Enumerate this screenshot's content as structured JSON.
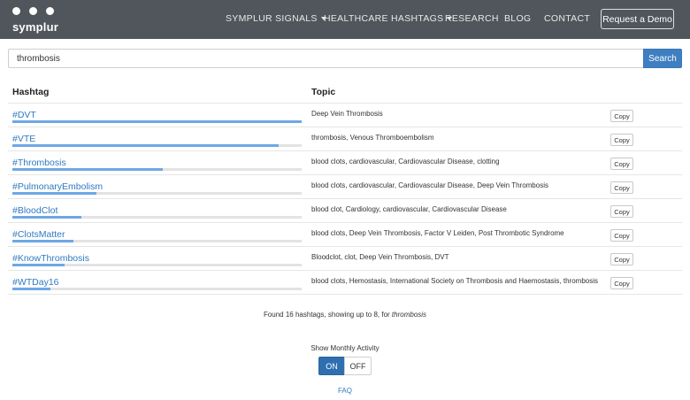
{
  "brand": {
    "name": "symplur"
  },
  "nav": {
    "items": [
      {
        "label": "SYMPLUR SIGNALS",
        "dropdown": true
      },
      {
        "label": "HEALTHCARE HASHTAGS",
        "dropdown": true
      },
      {
        "label": "RESEARCH",
        "dropdown": false
      },
      {
        "label": "BLOG",
        "dropdown": false
      },
      {
        "label": "CONTACT",
        "dropdown": false
      }
    ],
    "demo_label": "Request a Demo"
  },
  "search": {
    "value": "thrombosis",
    "button_label": "Search"
  },
  "table": {
    "headers": {
      "hashtag": "Hashtag",
      "topic": "Topic"
    },
    "copy_label": "Copy",
    "rows": [
      {
        "hashtag": "#DVT",
        "topic": "Deep Vein Thrombosis",
        "activity": 1.0
      },
      {
        "hashtag": "#VTE",
        "topic": "thrombosis, Venous Thromboembolism",
        "activity": 0.92
      },
      {
        "hashtag": "#Thrombosis",
        "topic": "blood clots, cardiovascular, Cardiovascular Disease, clotting",
        "activity": 0.52
      },
      {
        "hashtag": "#PulmonaryEmbolism",
        "topic": "blood clots, cardiovascular, Cardiovascular Disease, Deep Vein Thrombosis",
        "activity": 0.29
      },
      {
        "hashtag": "#BloodClot",
        "topic": "blood clot, Cardiology, cardiovascular, Cardiovascular Disease",
        "activity": 0.24
      },
      {
        "hashtag": "#ClotsMatter",
        "topic": "blood clots, Deep Vein Thrombosis, Factor V Leiden, Post Thrombotic Syndrome",
        "activity": 0.21
      },
      {
        "hashtag": "#KnowThrombosis",
        "topic": "Bloodclot, clot, Deep Vein Thrombosis, DVT",
        "activity": 0.18
      },
      {
        "hashtag": "#WTDay16",
        "topic": "blood clots, Hemostasis, International Society on Thrombosis and Haemostasis, thrombosis",
        "activity": 0.13
      }
    ]
  },
  "summary": {
    "text": "Found 16 hashtags, showing up to 8, for ",
    "term": "thrombosis"
  },
  "monthly_activity": {
    "label": "Show Monthly Activity",
    "on_label": "ON",
    "off_label": "OFF",
    "state": "ON"
  },
  "footer": {
    "faq_label": "FAQ"
  },
  "colors": {
    "navbar": "#51565c",
    "accent": "#3f7fc1",
    "link": "#2f79c0",
    "bar": "#6ea7e6"
  }
}
